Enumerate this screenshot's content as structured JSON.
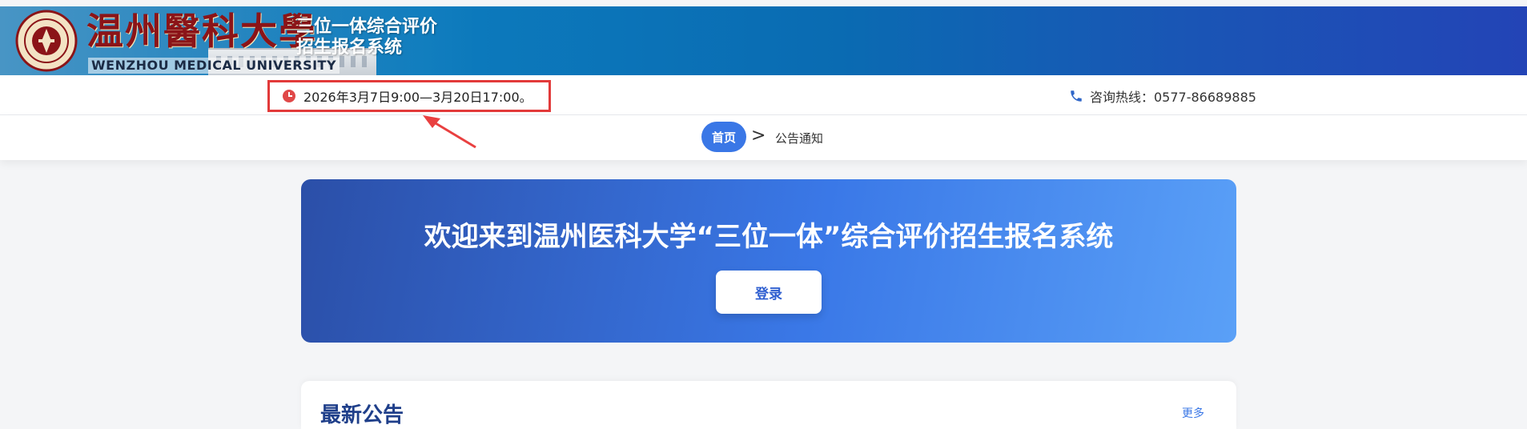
{
  "header": {
    "logo_cn": "温州醫科大學",
    "logo_en": "WENZHOU MEDICAL UNIVERSITY",
    "system_title_line1": "三位一体综合评价",
    "system_title_line2": "招生报名系统"
  },
  "info_bar": {
    "time_text": "2026年3月7日9:00—3月20日17:00。",
    "hotline_text": "咨询热线：0577-86689885"
  },
  "breadcrumb": {
    "home": "首页",
    "separator": ">",
    "current": "公告通知"
  },
  "hero": {
    "title": "欢迎来到温州医科大学“三位一体”综合评价招生报名系统",
    "login_label": "登录"
  },
  "notice": {
    "title": "最新公告",
    "more": "更多"
  },
  "colors": {
    "accent": "#3a77e6",
    "highlight_border": "#e23a3a",
    "logo_red": "#8b1418"
  }
}
